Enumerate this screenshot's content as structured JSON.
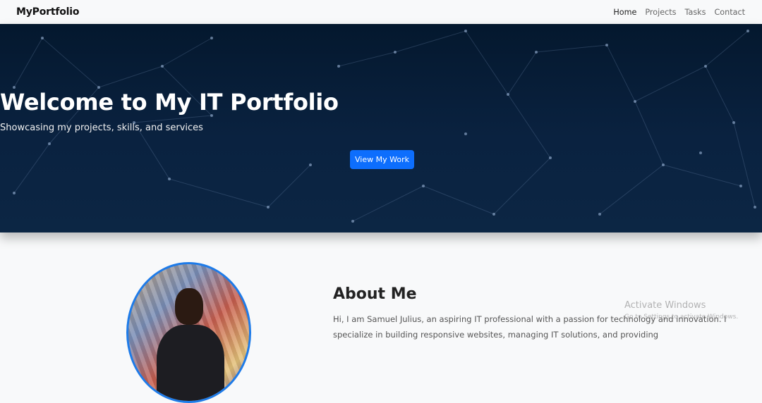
{
  "navbar": {
    "brand": "MyPortfolio",
    "links": [
      {
        "label": "Home",
        "active": true
      },
      {
        "label": "Projects",
        "active": false
      },
      {
        "label": "Tasks",
        "active": false
      },
      {
        "label": "Contact",
        "active": false
      }
    ]
  },
  "hero": {
    "title": "Welcome to My IT Portfolio",
    "subtitle": "Showcasing my projects, skills, and services",
    "button_label": "View My Work",
    "button_color": "#0d6efd",
    "background_color": "#0a2240"
  },
  "about": {
    "photo_icon": "profile-photo",
    "title": "About Me",
    "text": "Hi, I am Samuel Julius, an aspiring IT professional with a passion for technology and innovation. I specialize in building responsive websites, managing IT solutions, and providing"
  },
  "watermark": {
    "title": "Activate Windows",
    "subtitle": "Go to Settings to activate Windows."
  }
}
